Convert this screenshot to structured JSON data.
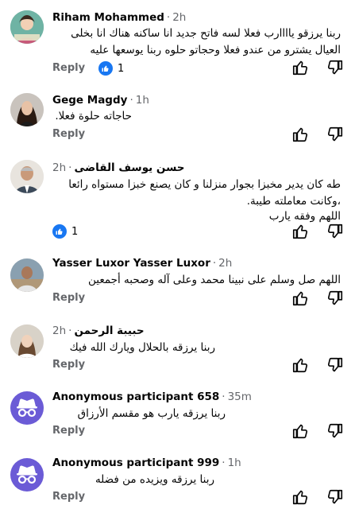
{
  "comments": [
    {
      "name": "Riham Mohammed",
      "time": "2h",
      "text": "ربنا يرزقو ياااارب فعلا لسه فاتح جديد انا ساكنه هناك انا بخلى العيال يشترو من عندو فعلا وحجاتو حلوه ربنا يوسعها عليه",
      "reply": "Reply",
      "reactions": "1",
      "avatar": "avatar-illustration"
    },
    {
      "name": "Gege Magdy",
      "time": "1h",
      "text": "حاجاته حلوة فعلا.",
      "reply": "Reply",
      "avatar": "avatar-photo"
    },
    {
      "name": "حسن يوسف القاضى",
      "time": "2h",
      "text": "طه كان يدير مخبزا بجوار منزلنا و كان يصنع خبزا مستواه رائعا ،وكانت معاملته طيبة.",
      "text2": "اللهم وفقه يارب",
      "reactions": "1",
      "avatar": "avatar-photo"
    },
    {
      "name": "Yasser Luxor Yasser Luxor",
      "time": "2h",
      "text": "اللهم صل وسلم على نبينا محمد وعلى آله وصحبه أجمعين",
      "reply": "Reply",
      "avatar": "avatar-photo"
    },
    {
      "name": "حبيبة الرحمن",
      "time": "2h",
      "text": "ربنا يرزقه بالحلال ويارك الله فيك",
      "reply": "Reply",
      "avatar": "avatar-photo"
    },
    {
      "name": "Anonymous participant 658",
      "time": "35m",
      "text": "ربنا يرزقه يارب هو مقسم الأرزاق",
      "reply": "Reply",
      "avatar": "anonymous-icon"
    },
    {
      "name": "Anonymous participant 999",
      "time": "1h",
      "text": "ربنا يرزقه ويزيده من فضله",
      "reply": "Reply",
      "avatar": "anonymous-icon"
    }
  ],
  "colors": {
    "like": "#1877f2",
    "anon": "#6b5bd6",
    "muted": "#65676b"
  },
  "icons": [
    "thumbs-up-icon",
    "thumbs-down-icon",
    "like-badge-icon",
    "anonymous-icon"
  ]
}
